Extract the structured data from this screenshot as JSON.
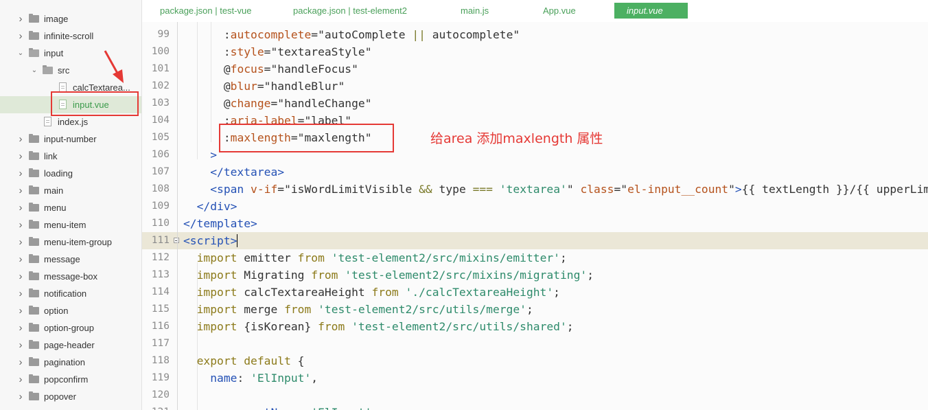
{
  "sidebar": {
    "items": [
      {
        "label": "image",
        "type": "folder",
        "expanded": false,
        "depth": 0
      },
      {
        "label": "infinite-scroll",
        "type": "folder",
        "expanded": false,
        "depth": 0
      },
      {
        "label": "input",
        "type": "folder",
        "expanded": true,
        "depth": 0
      },
      {
        "label": "src",
        "type": "folder",
        "expanded": true,
        "depth": 1
      },
      {
        "label": "calcTextarea...",
        "type": "file",
        "depth": 2
      },
      {
        "label": "input.vue",
        "type": "vue-file",
        "depth": 2,
        "selected": true
      },
      {
        "label": "index.js",
        "type": "file",
        "depth": 1
      },
      {
        "label": "input-number",
        "type": "folder",
        "expanded": false,
        "depth": 0
      },
      {
        "label": "link",
        "type": "folder",
        "expanded": false,
        "depth": 0
      },
      {
        "label": "loading",
        "type": "folder",
        "expanded": false,
        "depth": 0
      },
      {
        "label": "main",
        "type": "folder",
        "expanded": false,
        "depth": 0
      },
      {
        "label": "menu",
        "type": "folder",
        "expanded": false,
        "depth": 0
      },
      {
        "label": "menu-item",
        "type": "folder",
        "expanded": false,
        "depth": 0
      },
      {
        "label": "menu-item-group",
        "type": "folder",
        "expanded": false,
        "depth": 0
      },
      {
        "label": "message",
        "type": "folder",
        "expanded": false,
        "depth": 0
      },
      {
        "label": "message-box",
        "type": "folder",
        "expanded": false,
        "depth": 0
      },
      {
        "label": "notification",
        "type": "folder",
        "expanded": false,
        "depth": 0
      },
      {
        "label": "option",
        "type": "folder",
        "expanded": false,
        "depth": 0
      },
      {
        "label": "option-group",
        "type": "folder",
        "expanded": false,
        "depth": 0
      },
      {
        "label": "page-header",
        "type": "folder",
        "expanded": false,
        "depth": 0
      },
      {
        "label": "pagination",
        "type": "folder",
        "expanded": false,
        "depth": 0
      },
      {
        "label": "popconfirm",
        "type": "folder",
        "expanded": false,
        "depth": 0
      },
      {
        "label": "popover",
        "type": "folder",
        "expanded": false,
        "depth": 0
      }
    ]
  },
  "tabs": [
    {
      "label": "package.json | test-vue",
      "active": false
    },
    {
      "label": "package.json | test-element2",
      "active": false
    },
    {
      "label": "main.js",
      "active": false
    },
    {
      "label": "App.vue",
      "active": false
    },
    {
      "label": "input.vue",
      "active": true
    }
  ],
  "editor": {
    "lines": [
      {
        "n": "99",
        "tokens": [
          [
            "      ",
            "p"
          ],
          [
            ":",
            "p"
          ],
          [
            "autocomplete",
            "attr"
          ],
          [
            "=\"autoComplete ",
            "str"
          ],
          [
            "||",
            "op"
          ],
          [
            " autocomplete\"",
            "str"
          ]
        ]
      },
      {
        "n": "100",
        "tokens": [
          [
            "      ",
            "p"
          ],
          [
            ":",
            "p"
          ],
          [
            "style",
            "attr"
          ],
          [
            "=\"textareaStyle\"",
            "str"
          ]
        ]
      },
      {
        "n": "101",
        "tokens": [
          [
            "      ",
            "p"
          ],
          [
            "@",
            "p"
          ],
          [
            "focus",
            "attr"
          ],
          [
            "=\"handleFocus\"",
            "str"
          ]
        ]
      },
      {
        "n": "102",
        "tokens": [
          [
            "      ",
            "p"
          ],
          [
            "@",
            "p"
          ],
          [
            "blur",
            "attr"
          ],
          [
            "=\"handleBlur\"",
            "str"
          ]
        ]
      },
      {
        "n": "103",
        "tokens": [
          [
            "      ",
            "p"
          ],
          [
            "@",
            "p"
          ],
          [
            "change",
            "attr"
          ],
          [
            "=\"handleChange\"",
            "str"
          ]
        ]
      },
      {
        "n": "104",
        "tokens": [
          [
            "      ",
            "p"
          ],
          [
            ":",
            "p"
          ],
          [
            "aria-label",
            "attr"
          ],
          [
            "=\"label\"",
            "str"
          ]
        ]
      },
      {
        "n": "105",
        "tokens": [
          [
            "      ",
            "p"
          ],
          [
            ":",
            "p"
          ],
          [
            "maxlength",
            "attr"
          ],
          [
            "=\"maxlength\"",
            "str"
          ]
        ]
      },
      {
        "n": "106",
        "tokens": [
          [
            "    ",
            "p"
          ],
          [
            ">",
            "tag"
          ]
        ]
      },
      {
        "n": "107",
        "tokens": [
          [
            "    ",
            "p"
          ],
          [
            "</textarea>",
            "tag"
          ]
        ]
      },
      {
        "n": "108",
        "tokens": [
          [
            "    ",
            "p"
          ],
          [
            "<span ",
            "tag"
          ],
          [
            "v-if",
            "attr"
          ],
          [
            "=\"isWordLimitVisible ",
            "str"
          ],
          [
            "&&",
            "op"
          ],
          [
            " type ",
            "str"
          ],
          [
            "===",
            "op"
          ],
          [
            " ",
            "str"
          ],
          [
            "'textarea'",
            "sq"
          ],
          [
            "\" ",
            "str"
          ],
          [
            "class",
            "attr"
          ],
          [
            "=\"",
            "str"
          ],
          [
            "el-input__count",
            "attr"
          ],
          [
            "\"",
            "str"
          ],
          [
            ">",
            "tag"
          ],
          [
            "{{ textLength }}/{{ upperLimit }}",
            "str"
          ]
        ]
      },
      {
        "n": "109",
        "tokens": [
          [
            "  ",
            "p"
          ],
          [
            "</div>",
            "tag"
          ]
        ]
      },
      {
        "n": "110",
        "tokens": [
          [
            "",
            "p"
          ],
          [
            "</template>",
            "tag"
          ]
        ]
      },
      {
        "n": "111",
        "tokens": [
          [
            "",
            "p"
          ],
          [
            "<script>",
            "tag"
          ]
        ],
        "current": true,
        "fold": true
      },
      {
        "n": "112",
        "tokens": [
          [
            "  ",
            "p"
          ],
          [
            "import",
            "kw"
          ],
          [
            " emitter ",
            "id"
          ],
          [
            "from",
            "kw"
          ],
          [
            " ",
            "p"
          ],
          [
            "'test-element2/src/mixins/emitter'",
            "sq"
          ],
          [
            ";",
            "p"
          ]
        ]
      },
      {
        "n": "113",
        "tokens": [
          [
            "  ",
            "p"
          ],
          [
            "import",
            "kw"
          ],
          [
            " Migrating ",
            "id"
          ],
          [
            "from",
            "kw"
          ],
          [
            " ",
            "p"
          ],
          [
            "'test-element2/src/mixins/migrating'",
            "sq"
          ],
          [
            ";",
            "p"
          ]
        ]
      },
      {
        "n": "114",
        "tokens": [
          [
            "  ",
            "p"
          ],
          [
            "import",
            "kw"
          ],
          [
            " calcTextareaHeight ",
            "id"
          ],
          [
            "from",
            "kw"
          ],
          [
            " ",
            "p"
          ],
          [
            "'./calcTextareaHeight'",
            "sq"
          ],
          [
            ";",
            "p"
          ]
        ]
      },
      {
        "n": "115",
        "tokens": [
          [
            "  ",
            "p"
          ],
          [
            "import",
            "kw"
          ],
          [
            " merge ",
            "id"
          ],
          [
            "from",
            "kw"
          ],
          [
            " ",
            "p"
          ],
          [
            "'test-element2/src/utils/merge'",
            "sq"
          ],
          [
            ";",
            "p"
          ]
        ]
      },
      {
        "n": "116",
        "tokens": [
          [
            "  ",
            "p"
          ],
          [
            "import",
            "kw"
          ],
          [
            " {isKorean} ",
            "id"
          ],
          [
            "from",
            "kw"
          ],
          [
            " ",
            "p"
          ],
          [
            "'test-element2/src/utils/shared'",
            "sq"
          ],
          [
            ";",
            "p"
          ]
        ]
      },
      {
        "n": "117",
        "tokens": [
          [
            "",
            "p"
          ]
        ]
      },
      {
        "n": "118",
        "tokens": [
          [
            "  ",
            "p"
          ],
          [
            "export",
            "kw"
          ],
          [
            " ",
            "p"
          ],
          [
            "default",
            "kw"
          ],
          [
            " {",
            "p"
          ]
        ]
      },
      {
        "n": "119",
        "tokens": [
          [
            "    ",
            "p"
          ],
          [
            "name",
            "prop"
          ],
          [
            ": ",
            "p"
          ],
          [
            "'ElInput'",
            "sq"
          ],
          [
            ",",
            "p"
          ]
        ]
      },
      {
        "n": "120",
        "tokens": [
          [
            "",
            "p"
          ]
        ]
      },
      {
        "n": "121",
        "tokens": [
          [
            "    ",
            "p"
          ],
          [
            "componentName",
            "prop"
          ],
          [
            ": ",
            "p"
          ],
          [
            "'ElInput'",
            "sq"
          ],
          [
            ",",
            "p"
          ]
        ]
      }
    ]
  },
  "annotation": {
    "text": "给area 添加maxlength 属性",
    "color": "#e53935"
  }
}
